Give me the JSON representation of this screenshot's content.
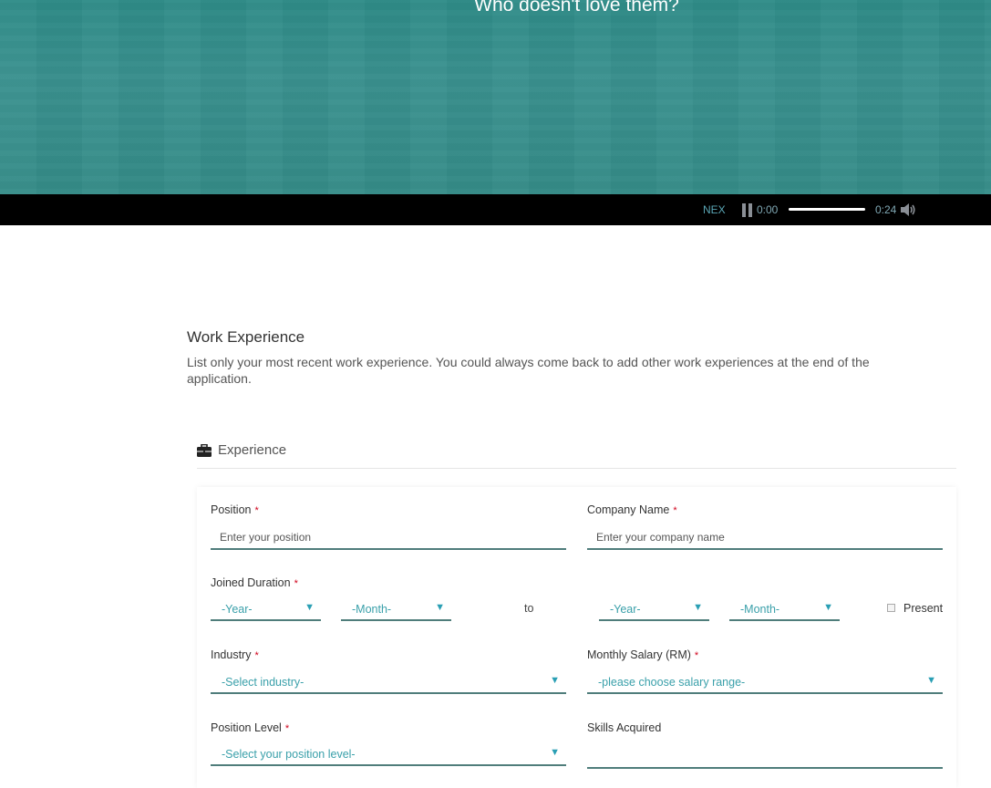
{
  "video": {
    "caption": "Who doesn't love them?",
    "next_label": "NEX",
    "time_current": "0:00",
    "time_duration": "0:24",
    "progress_fraction": 0.0
  },
  "section": {
    "title": "Work Experience",
    "description": "List only your most recent work experience. You could always come back to add other work experiences at the end of the application."
  },
  "panel": {
    "title": "Experience",
    "icon": "briefcase-icon"
  },
  "form": {
    "required_mark": "*",
    "position": {
      "label": "Position",
      "placeholder": "Enter your position"
    },
    "company": {
      "label": "Company Name",
      "placeholder": "Enter your company name"
    },
    "duration": {
      "label": "Joined Duration",
      "from_year": "-Year-",
      "from_month": "-Month-",
      "to_label": "to",
      "to_year": "-Year-",
      "to_month": "-Month-",
      "present_label": "Present"
    },
    "industry": {
      "label": "Industry",
      "value": "-Select industry-"
    },
    "salary": {
      "label": "Monthly Salary (RM)",
      "value": "-please choose salary range-"
    },
    "position_level": {
      "label": "Position Level",
      "value": "-Select your position level-"
    },
    "skills": {
      "label": "Skills Acquired"
    }
  },
  "colors": {
    "video_bg": "#3a918f",
    "accent": "#3aa0aa",
    "field_underline": "#4f7d7b",
    "required": "#d0021b"
  }
}
